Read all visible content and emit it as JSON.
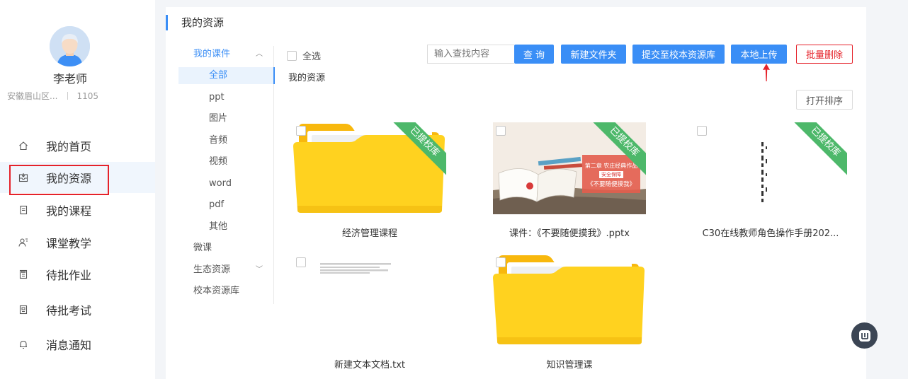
{
  "profile": {
    "name": "李老师",
    "school": "安徽眉山区...",
    "id": "1105"
  },
  "nav": [
    {
      "label": "我的首页",
      "icon": "home-icon"
    },
    {
      "label": "我的资源",
      "icon": "resource-box-icon",
      "active": true
    },
    {
      "label": "我的课程",
      "icon": "course-book-icon"
    },
    {
      "label": "课堂教学",
      "icon": "teaching-user-icon"
    },
    {
      "label": "待批作业",
      "icon": "homework-doc-icon"
    },
    {
      "label": "待批考试",
      "icon": "exam-doc-icon"
    },
    {
      "label": "消息通知",
      "icon": "bell-icon"
    }
  ],
  "panel": {
    "title": "我的资源"
  },
  "tree": {
    "courseware": "我的课件",
    "subs": [
      "全部",
      "ppt",
      "图片",
      "音频",
      "视频",
      "word",
      "pdf",
      "其他"
    ],
    "micro": "微课",
    "eco": "生态资源",
    "school": "校本资源库"
  },
  "toolbar": {
    "select_all": "全选",
    "search_placeholder": "输入查找内容",
    "search_btn": "查 询",
    "new_folder": "新建文件夹",
    "submit_school": "提交至校本资源库",
    "local_upload": "本地上传",
    "batch_delete": "批量删除",
    "sort": "打开排序"
  },
  "breadcrumb": "我的资源",
  "files": [
    {
      "name": "经济管理课程",
      "type": "folder",
      "ribbon": "已提校库"
    },
    {
      "name": "课件：《不要随便摸我》.pptx",
      "type": "pptx",
      "ribbon": "已提校库",
      "thumb_text": {
        "chapter": "第二章 农庄经典作品",
        "badge": "安全保障",
        "title": "《不要随便摸我》"
      }
    },
    {
      "name": "C30在线教师角色操作手册202...",
      "type": "doc",
      "ribbon": "已提校库"
    },
    {
      "name": "新建文本文档.txt",
      "type": "txt"
    },
    {
      "name": "知识管理课",
      "type": "folder"
    }
  ],
  "colors": {
    "accent": "#3a8ef6",
    "danger": "#e5222a",
    "ribbon": "#4db86a",
    "folder": "#ffd21f"
  }
}
